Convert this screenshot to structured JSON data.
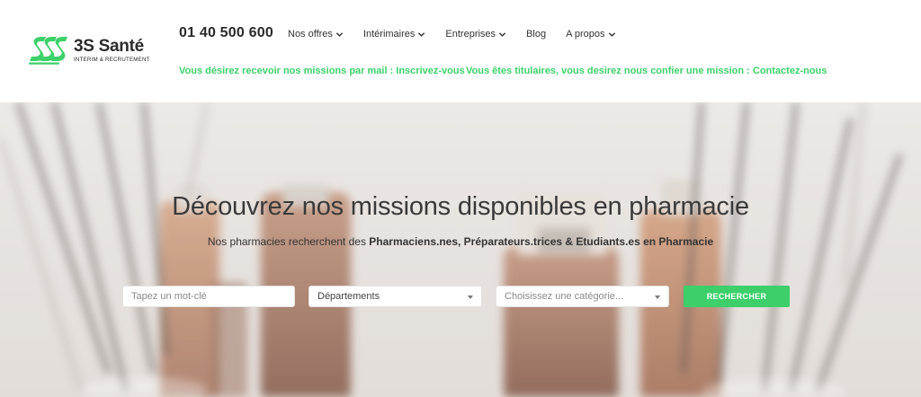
{
  "brand": {
    "name": "3S Santé",
    "tagline": "INTERIM & RECRUTEMENT",
    "accent": "#3dd16a"
  },
  "header": {
    "phone": "01 40 500 600",
    "nav": [
      {
        "label": "Nos offres",
        "dropdown": true
      },
      {
        "label": "Intérimaires",
        "dropdown": true
      },
      {
        "label": "Entreprises",
        "dropdown": true
      },
      {
        "label": "Blog",
        "dropdown": false
      },
      {
        "label": "A propos",
        "dropdown": true
      }
    ],
    "promo_subscribe": "Vous désirez recevoir nos missions par mail : Inscrivez-vous",
    "promo_contact": "Vous êtes titulaires, vous desirez nous confier une mission : Contactez-nous"
  },
  "hero": {
    "title": "Découvrez nos missions disponibles en pharmacie",
    "subtitle_prefix": "Nos pharmacies recherchent des ",
    "subtitle_bold": "Pharmaciens.nes, Préparateurs.trices & Etudiants.es en Pharmacie"
  },
  "search": {
    "keyword_placeholder": "Tapez un mot-clé",
    "departments_value": "Départements",
    "category_value": "Choisissez une catégorie...",
    "submit_label": "RECHERCHER",
    "button_color": "#3ccf6a"
  }
}
